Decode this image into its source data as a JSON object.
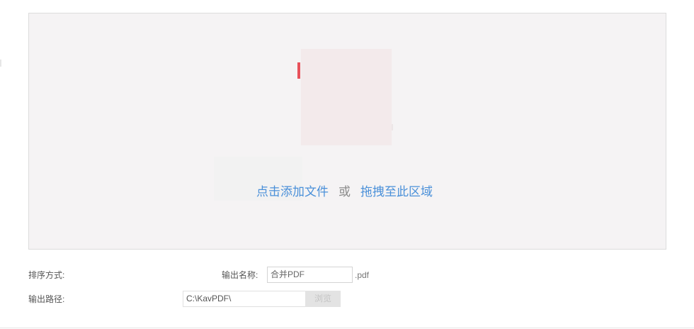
{
  "dropzone": {
    "add_link": "点击添加文件",
    "or_text": "或",
    "drag_link": "拖拽至此区域",
    "illustration": "pdf-document-icon",
    "accent_color": "#e8515a",
    "link_color": "#4a90d9"
  },
  "options": {
    "sort_label": "排序方式:",
    "output_name_label": "输出名称:",
    "output_name_value": "合并PDF",
    "output_name_suffix": ".pdf",
    "output_path_label": "输出路径:",
    "output_path_value": "C:\\KavPDF\\",
    "browse_label": "浏览"
  }
}
